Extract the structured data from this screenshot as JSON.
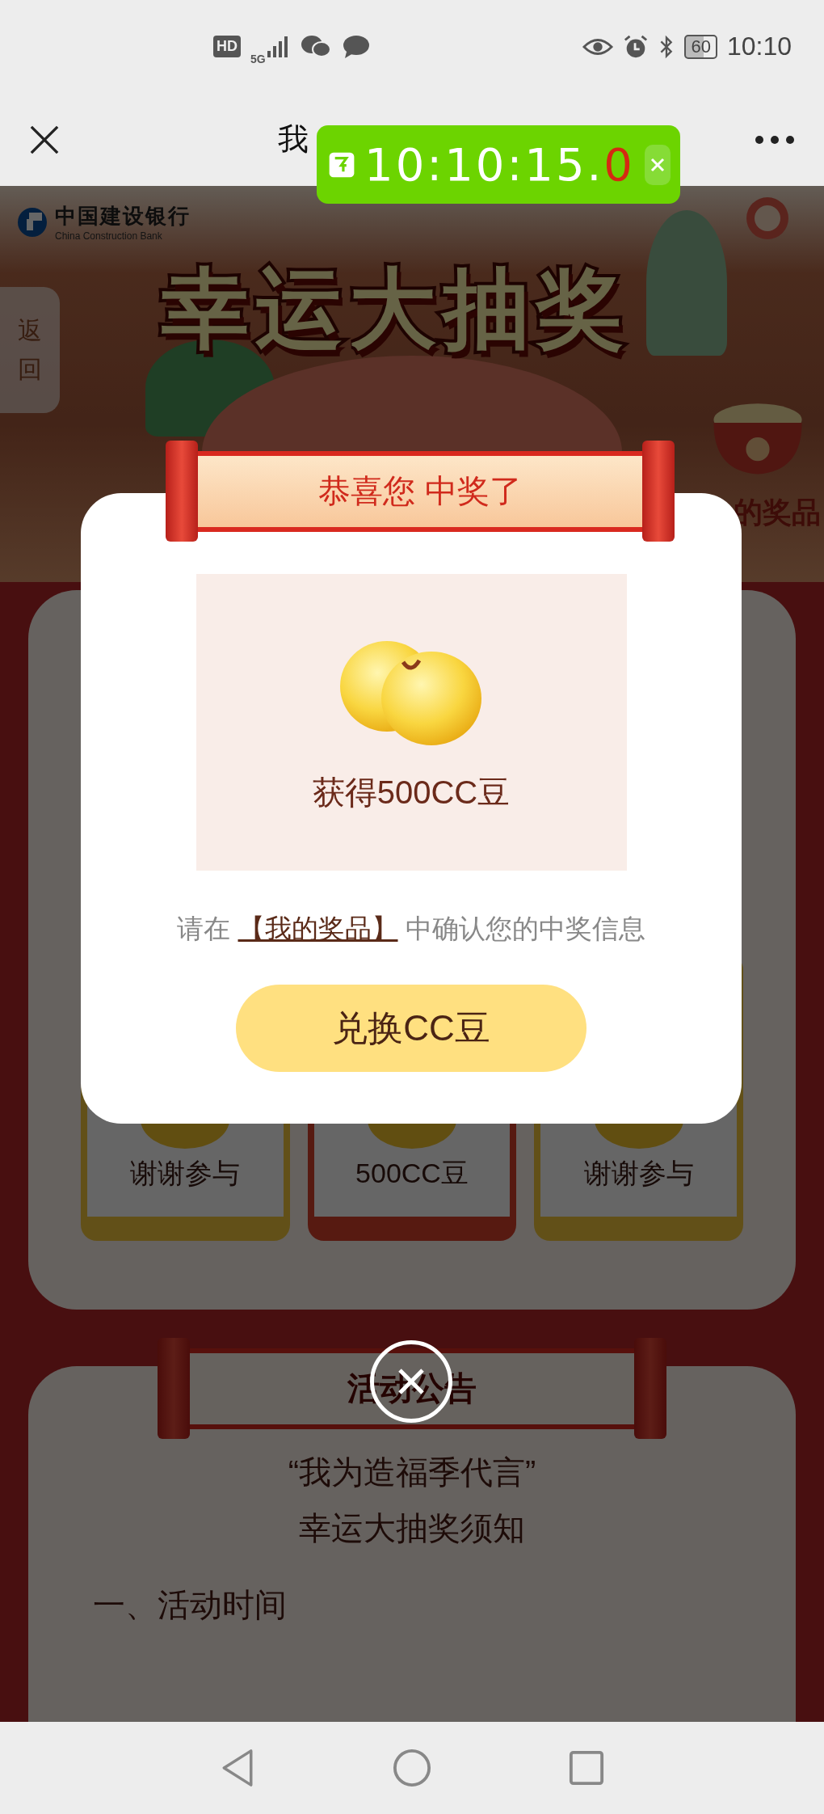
{
  "status_bar": {
    "network_badge": "HD",
    "network_type": "5G",
    "battery": "60",
    "time": "10:10"
  },
  "nav_bar": {
    "title": "我"
  },
  "timer_overlay": {
    "time": "10:10:15.",
    "time_last_digit": "0"
  },
  "page": {
    "bank_name": "中国建设银行",
    "bank_name_en": "China Construction Bank",
    "back_tab": "返回",
    "banner_title": "幸运大抽奖",
    "my_prizes_label": "的奖品",
    "prizes": [
      {
        "label": "谢谢参与",
        "selected": false
      },
      {
        "label": "500CC豆",
        "selected": true
      },
      {
        "label": "谢谢参与",
        "selected": false
      }
    ],
    "notice": {
      "heading": "活动公告",
      "title_lines": [
        "“我为造福季代言”",
        "幸运大抽奖须知"
      ],
      "section": "一、活动时间"
    }
  },
  "modal": {
    "ribbon_title": "恭喜您 中奖了",
    "prize_text": "获得500CC豆",
    "hint_prefix": "请在",
    "hint_link": "【我的奖品】",
    "hint_suffix": "中确认您的中奖信息",
    "button": "兑换CC豆"
  }
}
